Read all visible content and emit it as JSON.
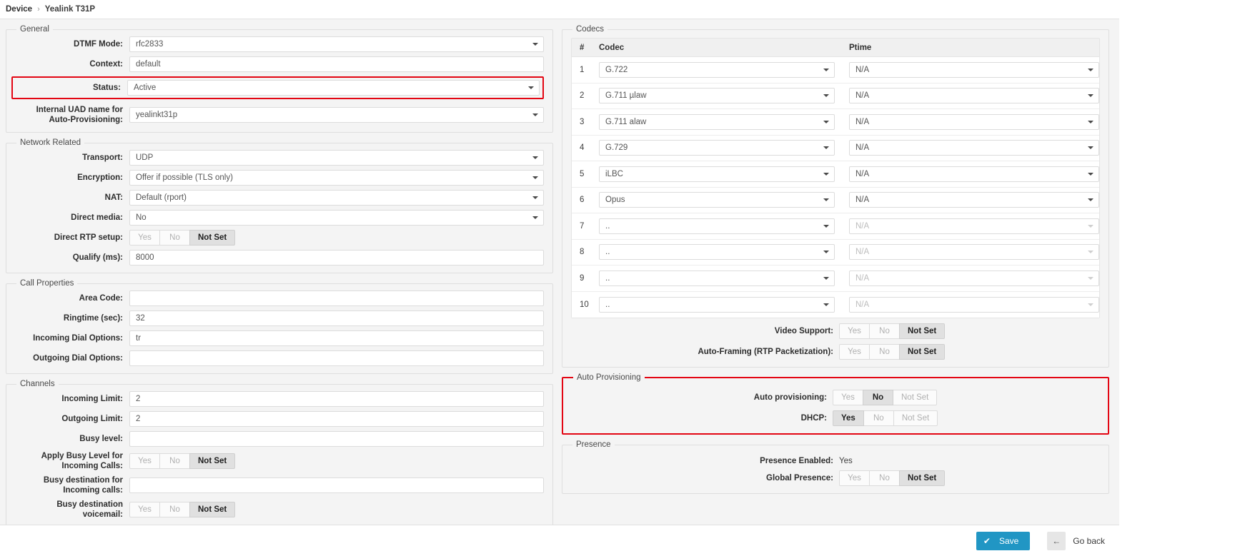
{
  "breadcrumb": {
    "root": "Device",
    "separator": "›",
    "current": "Yealink T31P"
  },
  "colors": {
    "highlight": "#e30613",
    "primary": "#2196c4"
  },
  "tristate": {
    "yes": "Yes",
    "no": "No",
    "not_set": "Not Set"
  },
  "general": {
    "legend": "General",
    "dtmf_mode": {
      "label": "DTMF Mode:",
      "value": "rfc2833"
    },
    "context": {
      "label": "Context:",
      "value": "default"
    },
    "status": {
      "label": "Status:",
      "value": "Active"
    },
    "internal_uad": {
      "label": "Internal UAD name for Auto-Provisioning:",
      "value": "yealinkt31p"
    }
  },
  "network": {
    "legend": "Network Related",
    "transport": {
      "label": "Transport:",
      "value": "UDP"
    },
    "encryption": {
      "label": "Encryption:",
      "value": "Offer if possible (TLS only)"
    },
    "nat": {
      "label": "NAT:",
      "value": "Default (rport)"
    },
    "direct_media": {
      "label": "Direct media:",
      "value": "No"
    },
    "direct_rtp_setup": {
      "label": "Direct RTP setup:",
      "selected": "Not Set"
    },
    "qualify": {
      "label": "Qualify (ms):",
      "value": "8000"
    }
  },
  "call_properties": {
    "legend": "Call Properties",
    "area_code": {
      "label": "Area Code:",
      "value": ""
    },
    "ringtime": {
      "label": "Ringtime (sec):",
      "value": "32"
    },
    "incoming_dial_options": {
      "label": "Incoming Dial Options:",
      "value": "tr"
    },
    "outgoing_dial_options": {
      "label": "Outgoing Dial Options:",
      "value": ""
    }
  },
  "channels": {
    "legend": "Channels",
    "incoming_limit": {
      "label": "Incoming Limit:",
      "value": "2"
    },
    "outgoing_limit": {
      "label": "Outgoing Limit:",
      "value": "2"
    },
    "busy_level": {
      "label": "Busy level:",
      "value": ""
    },
    "apply_busy_level": {
      "label": "Apply Busy Level for Incoming Calls:",
      "selected": "Not Set"
    },
    "busy_destination_incoming": {
      "label": "Busy destination for Incoming calls:",
      "value": ""
    },
    "busy_destination_voicemail": {
      "label": "Busy destination voicemail:",
      "selected": "Not Set"
    }
  },
  "codecs": {
    "legend": "Codecs",
    "headers": {
      "num": "#",
      "codec": "Codec",
      "ptime": "Ptime"
    },
    "rows": [
      {
        "num": "1",
        "codec": "G.722",
        "ptime": "N/A",
        "enabled": true
      },
      {
        "num": "2",
        "codec": "G.711 µlaw",
        "ptime": "N/A",
        "enabled": true
      },
      {
        "num": "3",
        "codec": "G.711 alaw",
        "ptime": "N/A",
        "enabled": true
      },
      {
        "num": "4",
        "codec": "G.729",
        "ptime": "N/A",
        "enabled": true
      },
      {
        "num": "5",
        "codec": "iLBC",
        "ptime": "N/A",
        "enabled": true
      },
      {
        "num": "6",
        "codec": "Opus",
        "ptime": "N/A",
        "enabled": true
      },
      {
        "num": "7",
        "codec": "..",
        "ptime": "N/A",
        "enabled": false
      },
      {
        "num": "8",
        "codec": "..",
        "ptime": "N/A",
        "enabled": false
      },
      {
        "num": "9",
        "codec": "..",
        "ptime": "N/A",
        "enabled": false
      },
      {
        "num": "10",
        "codec": "..",
        "ptime": "N/A",
        "enabled": false
      }
    ],
    "video_support": {
      "label": "Video Support:",
      "selected": "Not Set"
    },
    "auto_framing": {
      "label": "Auto-Framing (RTP Packetization):",
      "selected": "Not Set"
    }
  },
  "auto_provisioning": {
    "legend": "Auto Provisioning",
    "auto_provisioning": {
      "label": "Auto provisioning:",
      "selected": "No"
    },
    "dhcp": {
      "label": "DHCP:",
      "selected": "Yes"
    }
  },
  "presence": {
    "legend": "Presence",
    "presence_enabled": {
      "label": "Presence Enabled:",
      "value": "Yes"
    },
    "global_presence": {
      "label": "Global Presence:",
      "selected": "Not Set"
    }
  },
  "footer": {
    "save_label": "Save",
    "save_icon": "✔",
    "back_label": "Go back",
    "back_icon": "←"
  }
}
